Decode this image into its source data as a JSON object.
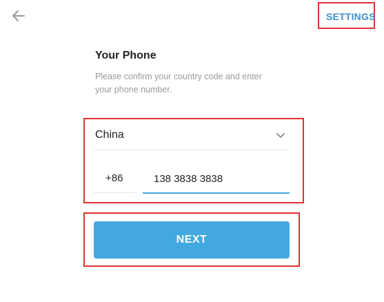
{
  "header": {
    "back_icon": "arrow-left-icon",
    "settings_label": "SETTINGS"
  },
  "main": {
    "title": "Your Phone",
    "description": "Please confirm your country code and enter your phone number.",
    "country": {
      "selected": "China",
      "icon": "chevron-down-icon"
    },
    "phone": {
      "country_code": "+86",
      "number": "138 3838 3838"
    },
    "next_label": "NEXT"
  },
  "colors": {
    "accent": "#44a8e0",
    "link": "#3a8fd0",
    "annotation": "#e0312f"
  }
}
